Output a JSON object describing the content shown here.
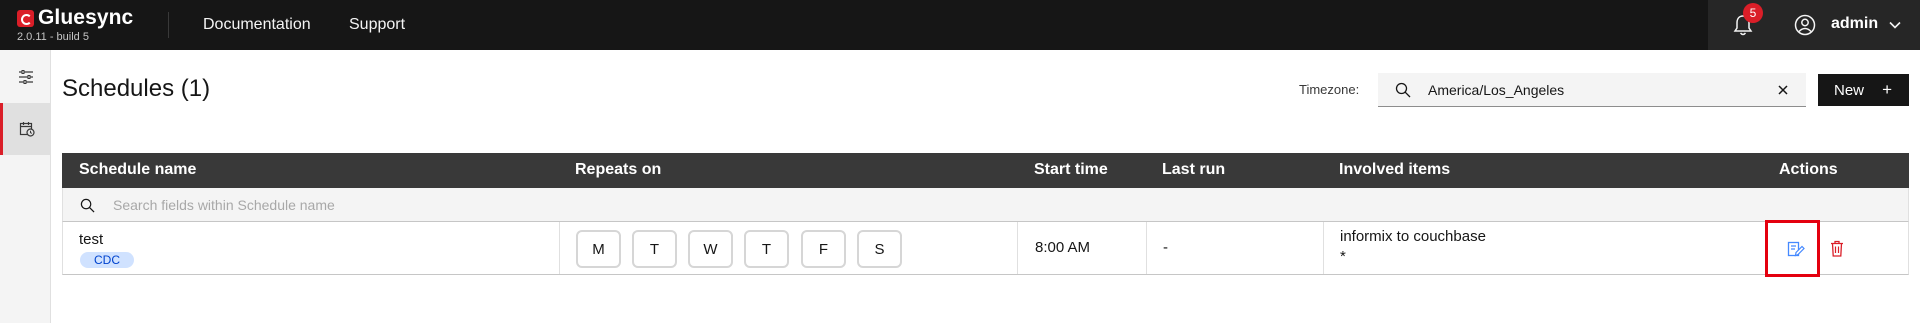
{
  "header": {
    "brand": "Gluesync",
    "version": "2.0.11 - build 5",
    "nav": [
      "Documentation",
      "Support"
    ],
    "notification_count": "5",
    "user": "admin"
  },
  "page": {
    "title": "Schedules (1)",
    "timezone_label": "Timezone:",
    "timezone_value": "America/Los_Angeles",
    "new_button": "New",
    "new_button_icon": "+"
  },
  "table": {
    "columns": [
      "Schedule name",
      "Repeats on",
      "Start time",
      "Last run",
      "Involved items",
      "Actions"
    ],
    "filter_placeholder": "Search fields within Schedule name",
    "rows": [
      {
        "name": "test",
        "tag": "CDC",
        "days": [
          "M",
          "T",
          "W",
          "T",
          "F",
          "S"
        ],
        "start_time": "8:00 AM",
        "last_run": "-",
        "involved_items": "informix to couchbase",
        "involved_items_extra": "*"
      }
    ]
  },
  "colors": {
    "header_bg": "#161616",
    "accent_red": "#da1e28",
    "table_header_bg": "#393939",
    "tag_bg": "#d0e2ff",
    "tag_text": "#0043ce",
    "edit_icon": "#4589ff",
    "delete_icon": "#da1e28",
    "highlight_box": "#e4000f"
  }
}
